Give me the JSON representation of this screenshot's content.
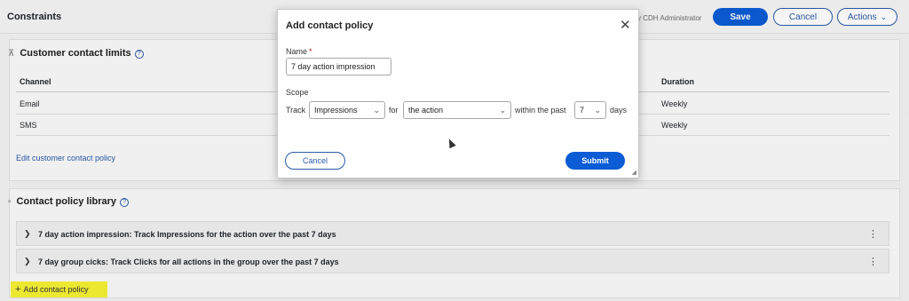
{
  "header": {
    "title": "Constraints",
    "user": "y CDH Administrator",
    "save_label": "Save",
    "cancel_label": "Cancel",
    "actions_label": "Actions"
  },
  "contact_limits": {
    "title": "Customer contact limits",
    "columns": [
      "Channel",
      "Duration"
    ],
    "rows": [
      {
        "channel": "Email",
        "duration": "Weekly"
      },
      {
        "channel": "SMS",
        "duration": "Weekly"
      }
    ],
    "edit_link": "Edit customer contact policy"
  },
  "policy_library": {
    "title": "Contact policy library",
    "items": [
      "7 day action impression: Track Impressions for the action over the past 7 days",
      "7 day group cicks: Track Clicks for all actions in the group over the past 7 days"
    ],
    "add_label": "Add contact policy"
  },
  "modal": {
    "title": "Add contact policy",
    "name_label": "Name",
    "required_mark": "*",
    "name_value": "7 day action impression",
    "scope_label": "Scope",
    "track_label": "Track",
    "track_value": "Impressions",
    "for_label": "for",
    "for_value": "the action",
    "within_label": "within the past",
    "days_value": "7",
    "days_label": "days",
    "cancel_label": "Cancel",
    "submit_label": "Submit"
  },
  "icons": {
    "close": "close-icon",
    "chevron_down": "chevron-down-icon",
    "chevron_right": "chevron-right-icon",
    "kebab": "more-vertical-icon",
    "help": "help-icon"
  },
  "colors": {
    "primary": "#0b5cd5",
    "link": "#2a5aa8",
    "highlight": "#f6f233",
    "required": "#c01f1f"
  }
}
